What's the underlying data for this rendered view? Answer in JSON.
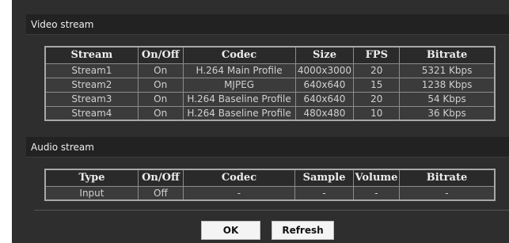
{
  "video": {
    "title": "Video stream",
    "headers": [
      "Stream",
      "On/Off",
      "Codec",
      "Size",
      "FPS",
      "Bitrate"
    ],
    "rows": [
      [
        "Stream1",
        "On",
        "H.264 Main Profile",
        "4000x3000",
        "20",
        "5321 Kbps"
      ],
      [
        "Stream2",
        "On",
        "MJPEG",
        "640x640",
        "15",
        "1238 Kbps"
      ],
      [
        "Stream3",
        "On",
        "H.264 Baseline Profile",
        "640x640",
        "20",
        "54 Kbps"
      ],
      [
        "Stream4",
        "On",
        "H.264 Baseline Profile",
        "480x480",
        "10",
        "36 Kbps"
      ]
    ]
  },
  "audio": {
    "title": "Audio stream",
    "headers": [
      "Type",
      "On/Off",
      "Codec",
      "Sample",
      "Volume",
      "Bitrate"
    ],
    "rows": [
      [
        "Input",
        "Off",
        "-",
        "-",
        "-",
        "-"
      ]
    ]
  },
  "buttons": {
    "ok_label": "OK",
    "refresh_label": "Refresh"
  }
}
